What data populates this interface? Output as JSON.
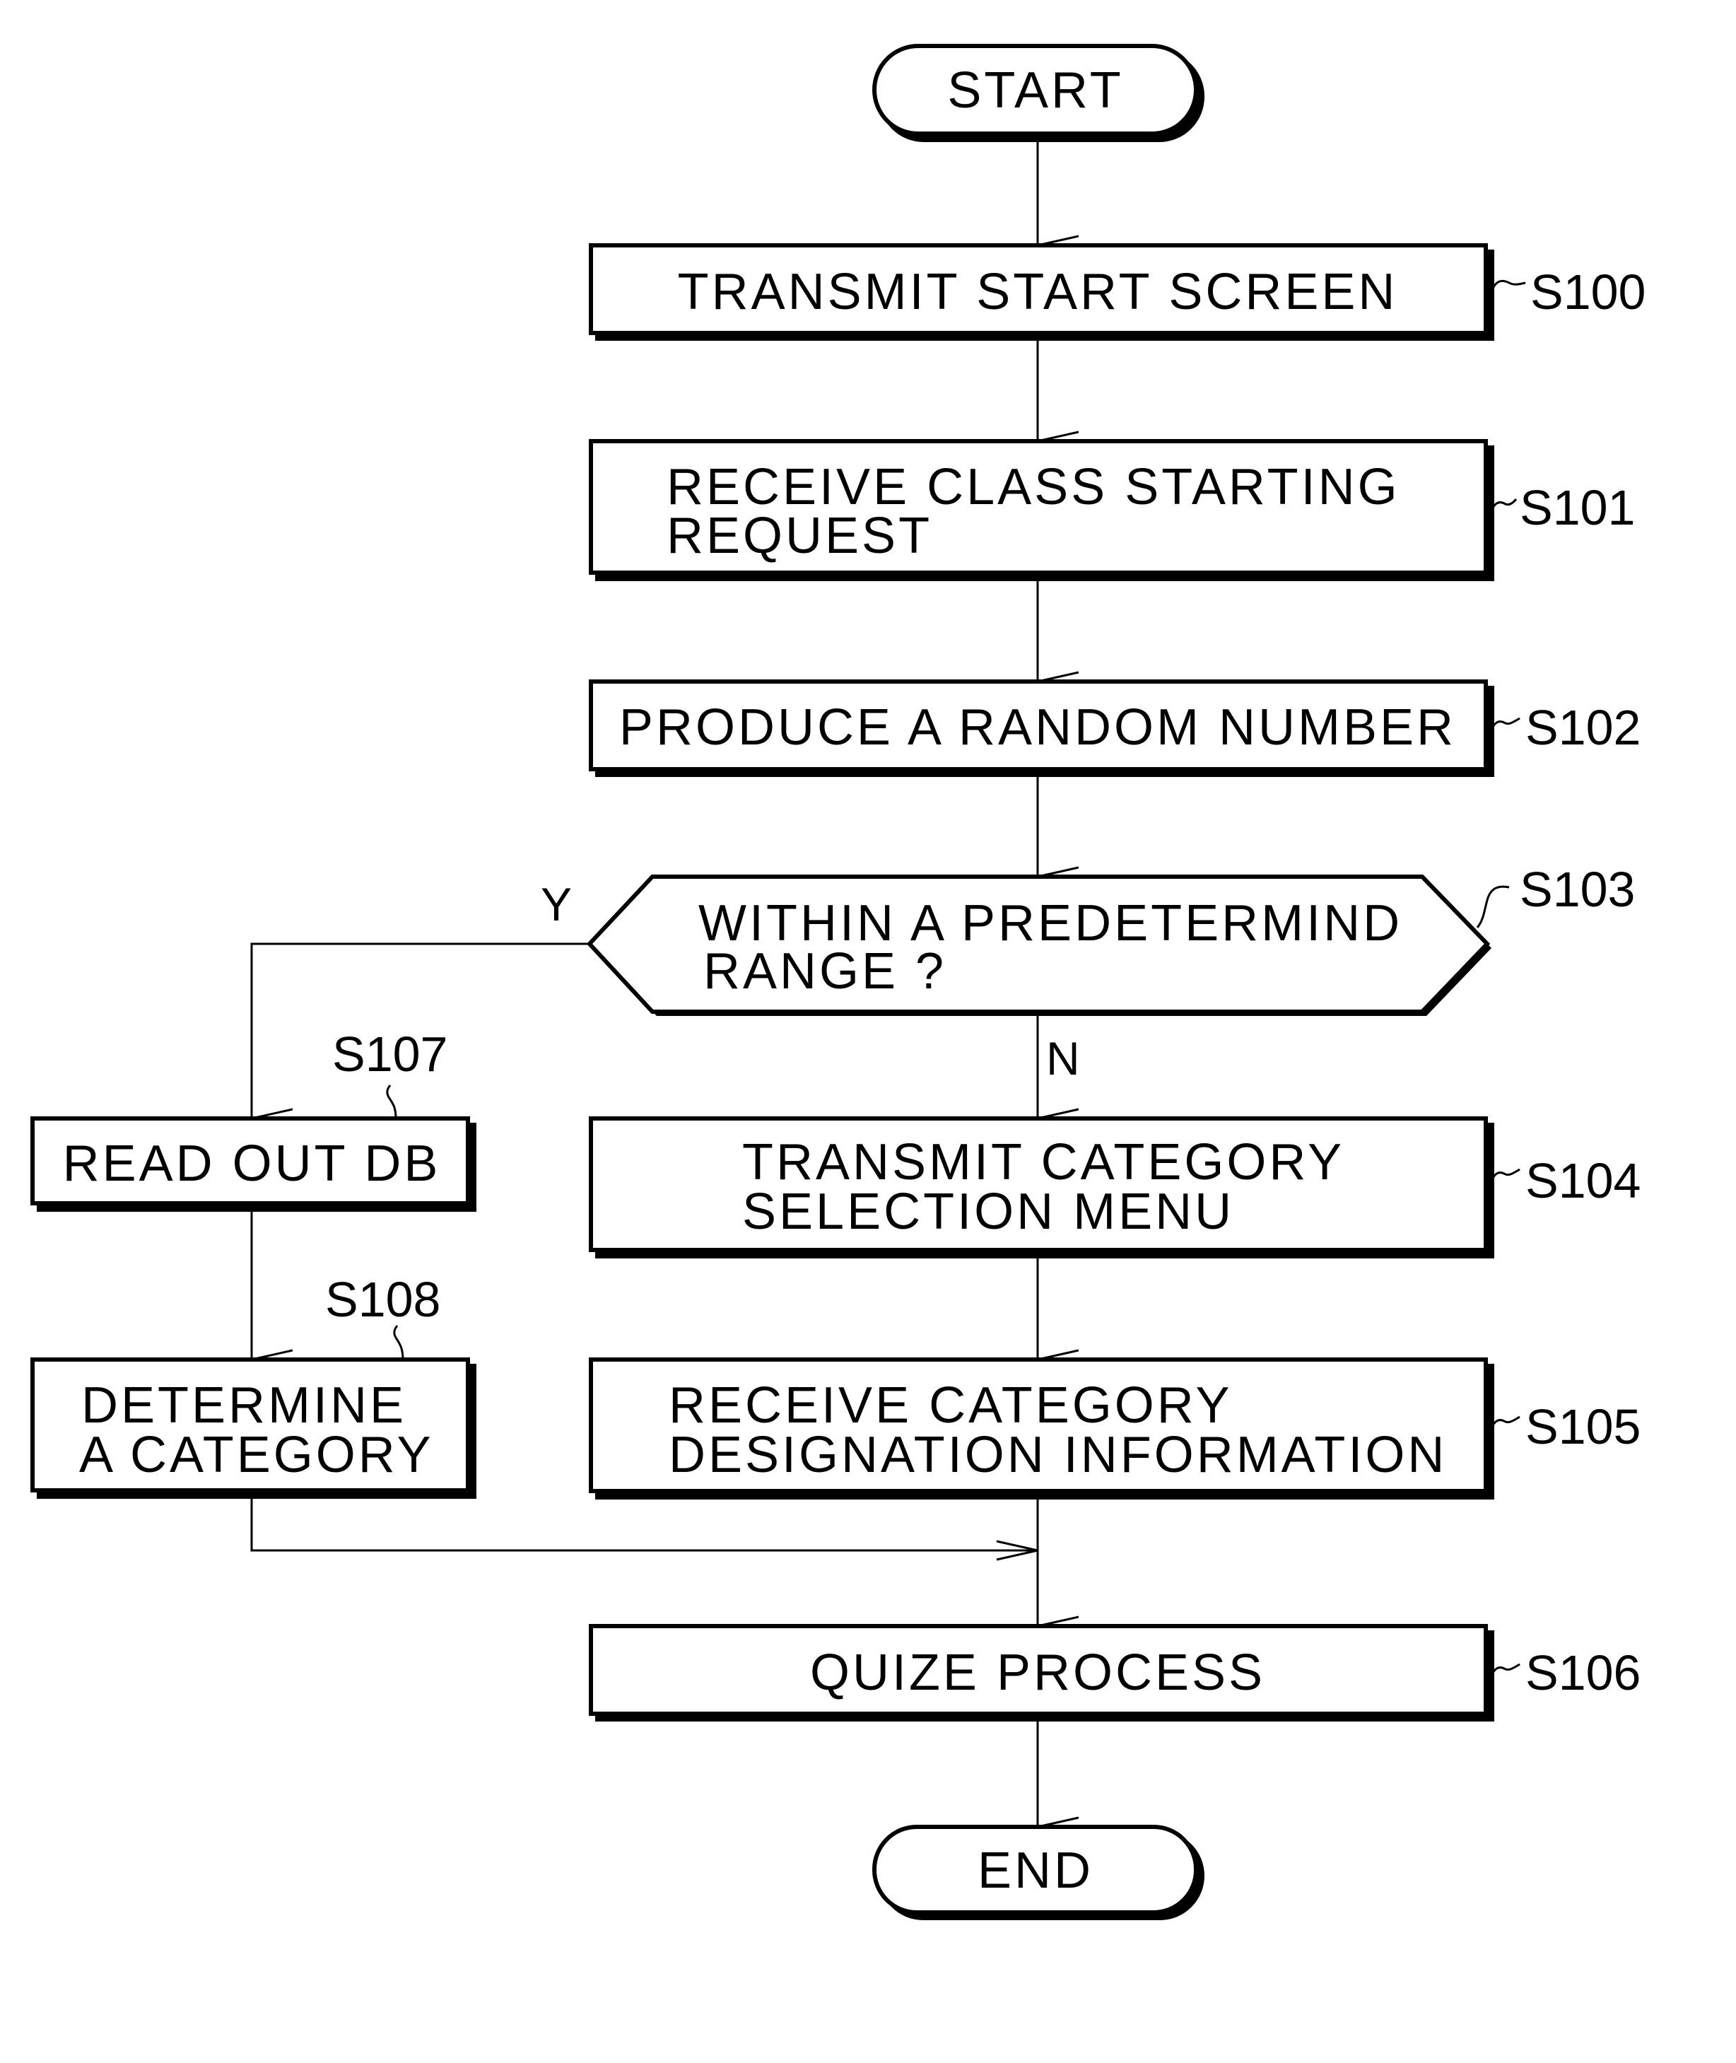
{
  "flowchart": {
    "start": "START",
    "end": "END",
    "steps": {
      "s100": {
        "id": "S100",
        "lines": [
          "TRANSMIT START SCREEN"
        ]
      },
      "s101": {
        "id": "S101",
        "lines": [
          "RECEIVE CLASS STARTING",
          "REQUEST"
        ]
      },
      "s102": {
        "id": "S102",
        "lines": [
          "PRODUCE A RANDOM NUMBER"
        ]
      },
      "s103": {
        "id": "S103",
        "lines": [
          "WITHIN A PREDETERMIND",
          "RANGE ?"
        ]
      },
      "s104": {
        "id": "S104",
        "lines": [
          "TRANSMIT CATEGORY",
          "SELECTION MENU"
        ]
      },
      "s105": {
        "id": "S105",
        "lines": [
          "RECEIVE CATEGORY",
          "DESIGNATION INFORMATION"
        ]
      },
      "s106": {
        "id": "S106",
        "lines": [
          "QUIZE PROCESS"
        ]
      },
      "s107": {
        "id": "S107",
        "lines": [
          "READ OUT DB"
        ]
      },
      "s108": {
        "id": "S108",
        "lines": [
          "DETERMINE",
          "A CATEGORY"
        ]
      }
    },
    "branch_yes": "Y",
    "branch_no": "N"
  }
}
